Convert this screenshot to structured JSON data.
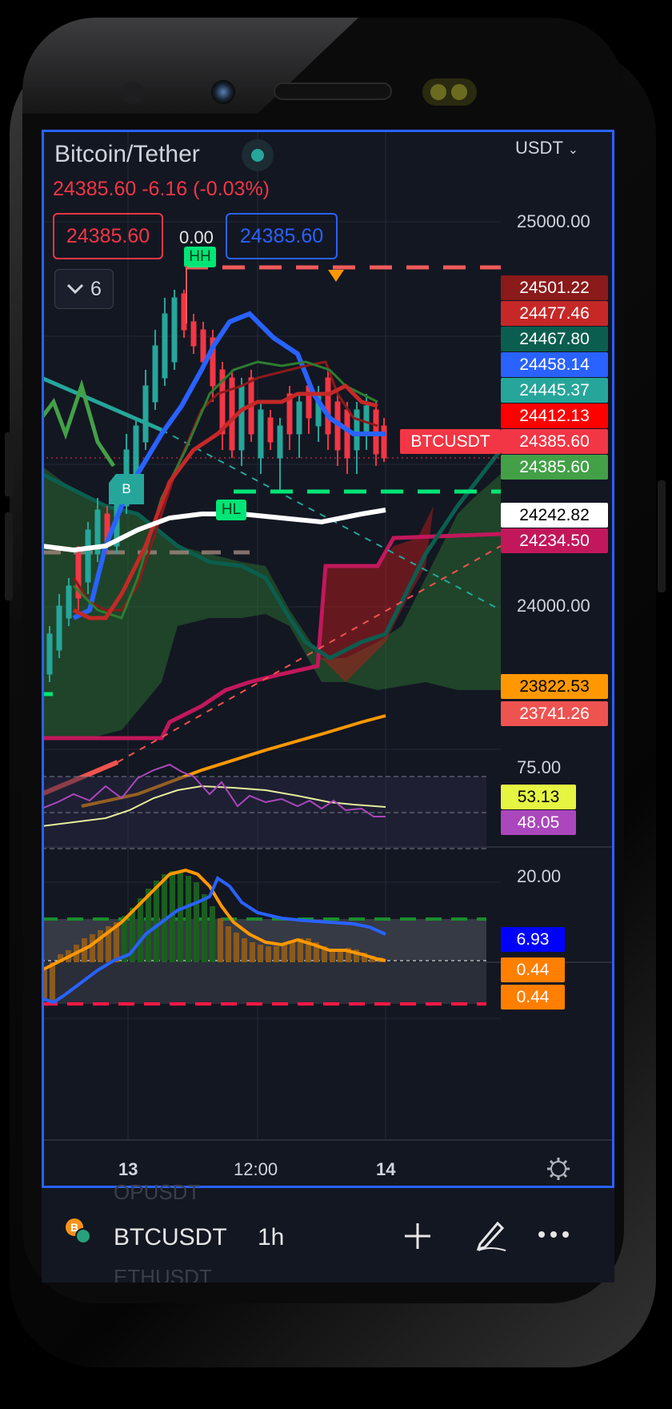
{
  "header": {
    "title": "Bitcoin/Tether",
    "price_line": "24385.60  -6.16 (-0.03%)",
    "currency": "USDT",
    "sell_price": "24385.60",
    "spread": "0.00",
    "buy_price": "24385.60",
    "indicator_count": "6"
  },
  "axis": {
    "price_labels": [
      "25000.00",
      "24000.00"
    ],
    "rsi_label": "75.00",
    "osc_label": "20.00",
    "time_labels": [
      "13",
      "12:00",
      "14"
    ]
  },
  "price_tags": [
    {
      "value": "24501.22",
      "color": "#8b1a1a"
    },
    {
      "value": "24477.46",
      "color": "#c62828"
    },
    {
      "value": "24467.80",
      "color": "#0b5e4f"
    },
    {
      "value": "24458.14",
      "color": "#2962ff"
    },
    {
      "value": "24445.37",
      "color": "#26a69a"
    },
    {
      "value": "24412.13",
      "color": "#ff0000"
    },
    {
      "value": "24385.60",
      "color": "#f23645"
    },
    {
      "value": "24385.60",
      "color": "#43a047"
    },
    {
      "value": "24242.82",
      "color": "#ffffff"
    },
    {
      "value": "24234.50",
      "color": "#c2185b"
    },
    {
      "value": "23822.53",
      "color": "#ff9800"
    },
    {
      "value": "23741.26",
      "color": "#ef5350"
    }
  ],
  "symbol_tag": "BTCUSDT",
  "rsi_tags": [
    "53.13",
    "48.05"
  ],
  "osc_tags": [
    "6.93",
    "0.44",
    "0.44"
  ],
  "markers": {
    "hh": "HH",
    "hl": "HL",
    "buy": "B"
  },
  "bottom_bar": {
    "symbol": "BTCUSDT",
    "interval": "1h",
    "ghost_above": "OPUSDT",
    "ghost_below": "ETHUSDT"
  },
  "icons": [
    "settings-gear-icon",
    "plus-icon",
    "pen-icon",
    "more-icon",
    "chevron-down-icon",
    "btc-coin-icon"
  ],
  "colors": {
    "up": "#26a69a",
    "down": "#f23645",
    "accent": "#2962ff",
    "bg": "#131722"
  }
}
